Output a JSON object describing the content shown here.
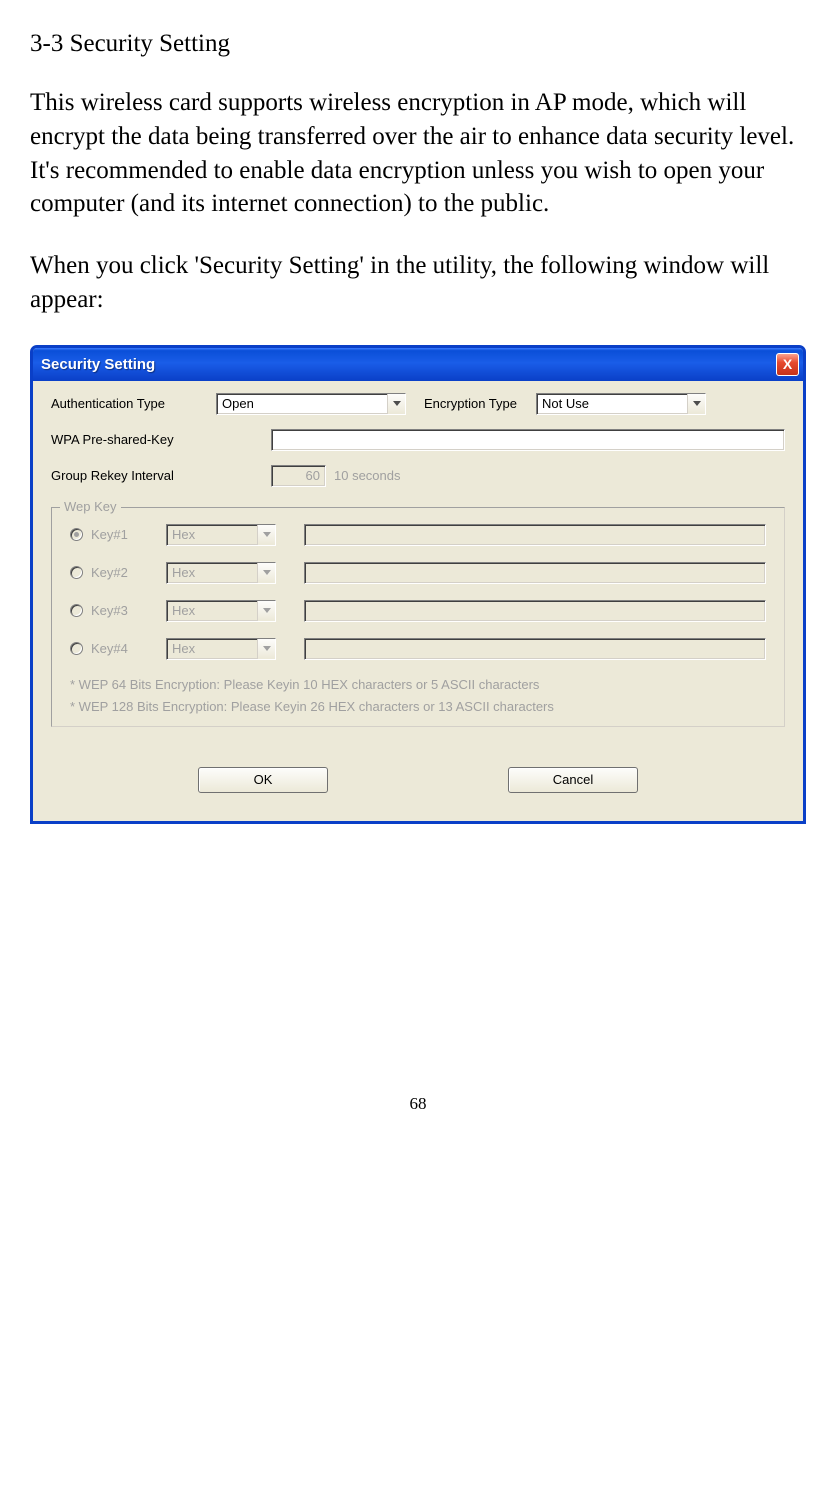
{
  "doc": {
    "heading": "3-3 Security Setting",
    "para1": "This wireless card supports wireless encryption in AP mode, which will encrypt the data being transferred over the air to enhance data security level. It's recommended to enable data encryption unless you wish to open your computer (and its internet connection) to the public.",
    "para2": "When you click 'Security Setting' in the utility, the following window will appear:",
    "page_number": "68"
  },
  "window": {
    "title": "Security Setting",
    "close_x": "X",
    "labels": {
      "auth_type": "Authentication Type",
      "encryption_type": "Encryption Type",
      "wpa_psk": "WPA Pre-shared-Key",
      "group_rekey": "Group Rekey Interval",
      "rekey_unit": "10 seconds",
      "wep_legend": "Wep Key"
    },
    "values": {
      "auth_type": "Open",
      "encryption_type": "Not Use",
      "wpa_psk": "",
      "rekey_value": "60"
    },
    "wep_keys": [
      {
        "label": "Key#1",
        "format": "Hex",
        "value": "",
        "selected": true
      },
      {
        "label": "Key#2",
        "format": "Hex",
        "value": "",
        "selected": false
      },
      {
        "label": "Key#3",
        "format": "Hex",
        "value": "",
        "selected": false
      },
      {
        "label": "Key#4",
        "format": "Hex",
        "value": "",
        "selected": false
      }
    ],
    "hints": {
      "line1": "* WEP   64 Bits Encryption:  Please Keyin 10 HEX characters or   5 ASCII characters",
      "line2": "* WEP 128 Bits Encryption:  Please Keyin 26 HEX characters or 13 ASCII characters"
    },
    "buttons": {
      "ok": "OK",
      "cancel": "Cancel"
    }
  }
}
